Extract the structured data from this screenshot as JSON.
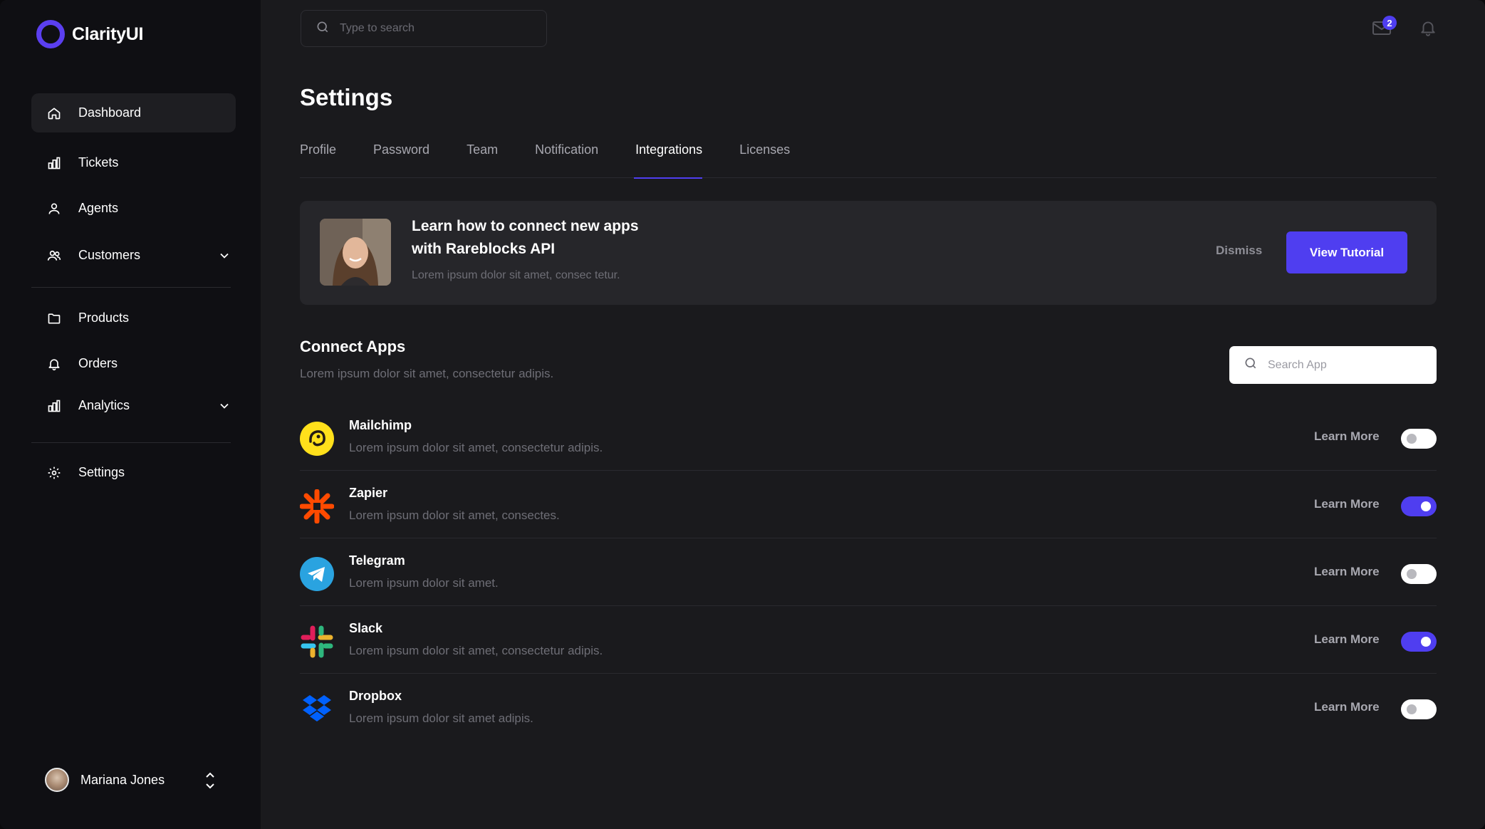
{
  "app": {
    "name": "ClarityUI"
  },
  "sidebar": {
    "items": [
      {
        "label": "Dashboard",
        "icon": "home-icon"
      },
      {
        "label": "Tickets",
        "icon": "bar-chart-icon"
      },
      {
        "label": "Agents",
        "icon": "user-icon"
      },
      {
        "label": "Customers",
        "icon": "users-icon"
      },
      {
        "label": "Products",
        "icon": "folder-icon"
      },
      {
        "label": "Orders",
        "icon": "bell-icon"
      },
      {
        "label": "Analytics",
        "icon": "bar-chart-icon"
      },
      {
        "label": "Settings",
        "icon": "gear-icon"
      }
    ],
    "user": {
      "name": "Mariana Jones"
    }
  },
  "header": {
    "search_placeholder": "Type to search",
    "mail_badge": "2"
  },
  "page": {
    "title": "Settings",
    "tabs": [
      "Profile",
      "Password",
      "Team",
      "Notification",
      "Integrations",
      "Licenses"
    ],
    "active_tab": "Integrations"
  },
  "banner": {
    "title_line1": "Learn how to connect new apps",
    "title_line2": "with Rareblocks API",
    "subtitle": "Lorem ipsum dolor sit amet, consec tetur.",
    "dismiss_label": "Dismiss",
    "cta_label": "View Tutorial"
  },
  "connect": {
    "title": "Connect Apps",
    "subtitle": "Lorem ipsum dolor sit amet, consectetur adipis.",
    "search_placeholder": "Search App",
    "learn_more_label": "Learn More",
    "apps": [
      {
        "name": "Mailchimp",
        "desc": "Lorem ipsum dolor sit amet, consectetur adipis.",
        "enabled": false,
        "color": "#ffe01b"
      },
      {
        "name": "Zapier",
        "desc": "Lorem ipsum dolor sit amet, consectes.",
        "enabled": true,
        "color": "#ff4a00"
      },
      {
        "name": "Telegram",
        "desc": "Lorem ipsum dolor sit amet.",
        "enabled": false,
        "color": "#2aa3e0"
      },
      {
        "name": "Slack",
        "desc": "Lorem ipsum dolor sit amet, consectetur adipis.",
        "enabled": true,
        "color": "#e01e5a"
      },
      {
        "name": "Dropbox",
        "desc": "Lorem ipsum dolor sit amet adipis.",
        "enabled": false,
        "color": "#0061fe"
      }
    ]
  },
  "colors": {
    "accent": "#4f3ef0",
    "background": "#1a1a1d",
    "sidebar": "#0f0f13"
  }
}
